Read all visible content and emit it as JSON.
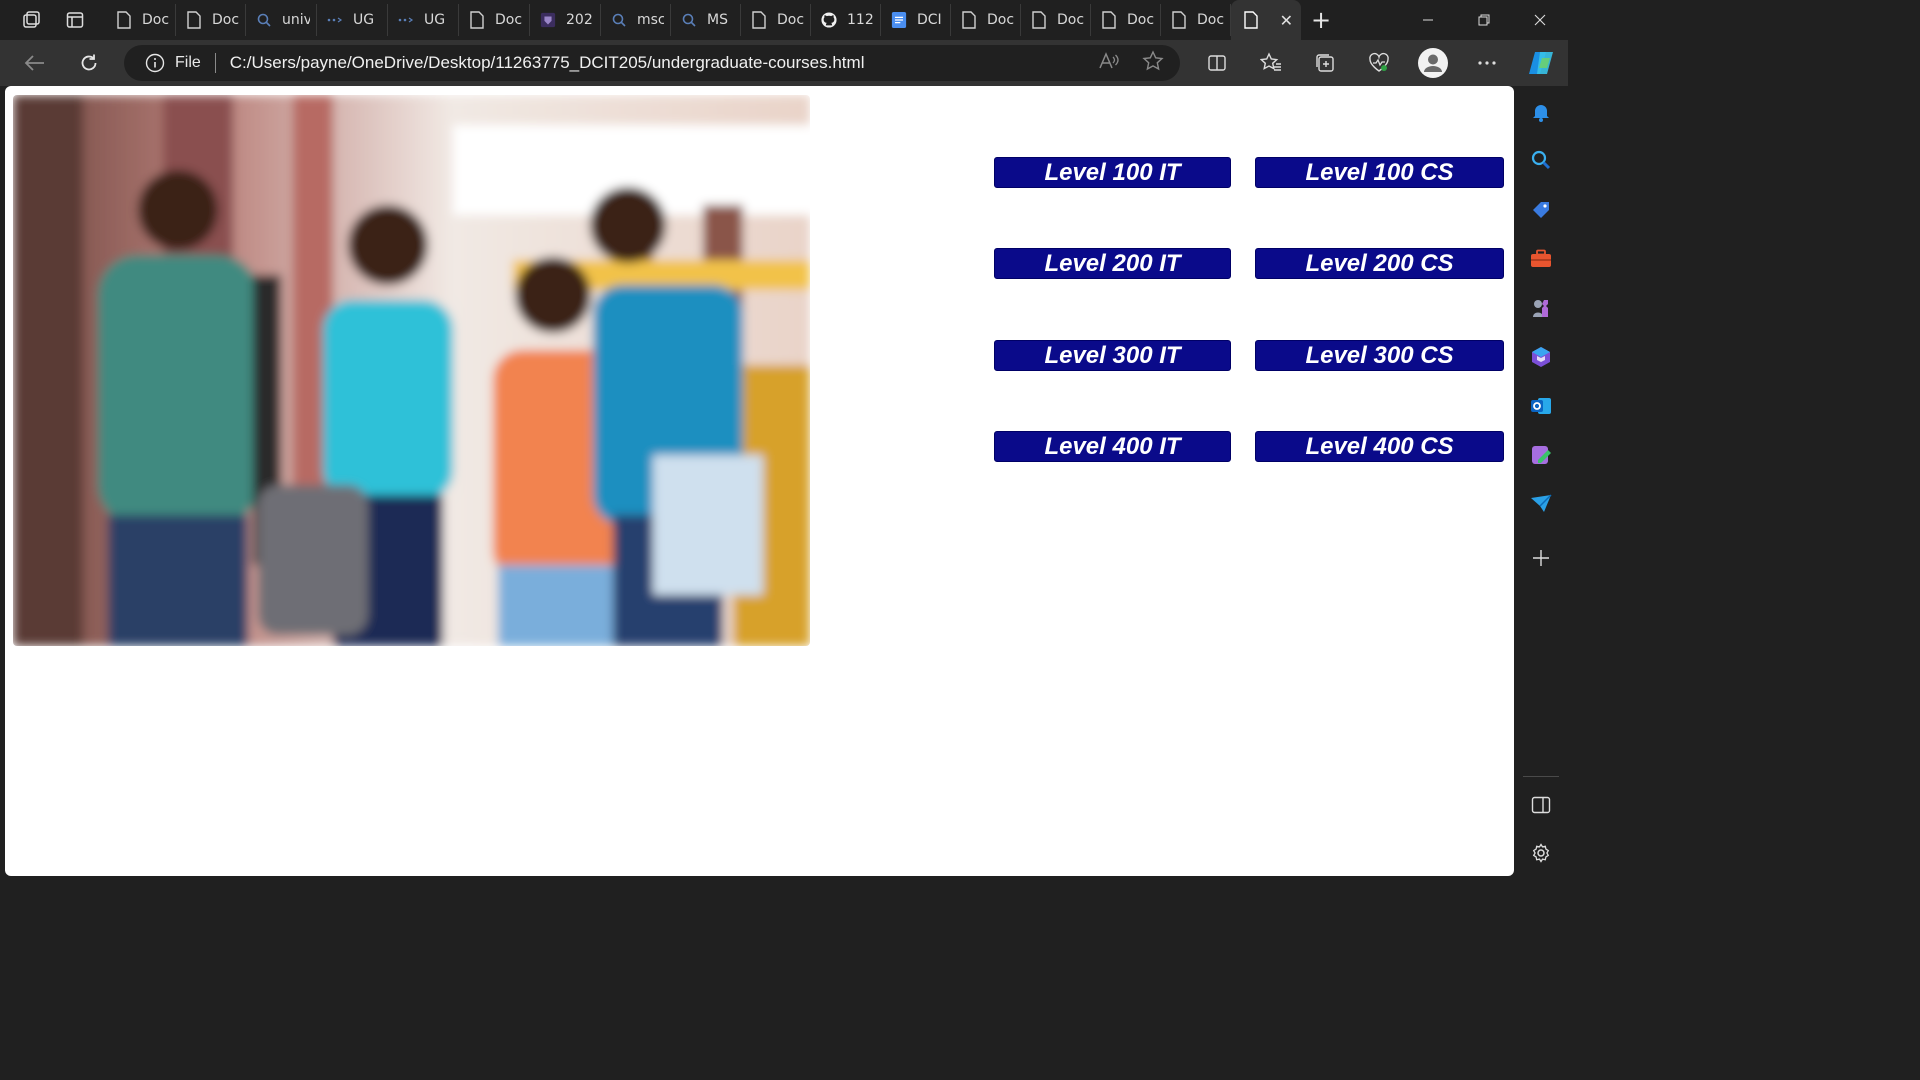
{
  "browser": {
    "tabs": [
      {
        "title": "Doc",
        "icon": "document-icon"
      },
      {
        "title": "Doc",
        "icon": "document-icon"
      },
      {
        "title": "univ",
        "icon": "search-icon"
      },
      {
        "title": "UG",
        "icon": "dots-icon"
      },
      {
        "title": "UG",
        "icon": "dots-icon"
      },
      {
        "title": "Doc",
        "icon": "document-icon"
      },
      {
        "title": "202",
        "icon": "crest-icon"
      },
      {
        "title": "msc",
        "icon": "search-icon"
      },
      {
        "title": "MS",
        "icon": "search-icon"
      },
      {
        "title": "Doc",
        "icon": "document-icon"
      },
      {
        "title": "112",
        "icon": "github-icon"
      },
      {
        "title": "DCI",
        "icon": "docs-icon"
      },
      {
        "title": "Doc",
        "icon": "document-icon"
      },
      {
        "title": "Doc",
        "icon": "document-icon"
      },
      {
        "title": "Doc",
        "icon": "document-icon"
      },
      {
        "title": "Doc",
        "icon": "document-icon"
      }
    ],
    "active_tab_close": "✕",
    "new_tab": "+",
    "address": {
      "scheme_label": "File",
      "url": "C:/Users/payne/OneDrive/Desktop/11263775_DCIT205/undergraduate-courses.html"
    }
  },
  "page": {
    "hero_image_alt": "students",
    "courses": {
      "it": [
        "Level 100 IT",
        "Level 200 IT",
        "Level 300 IT",
        "Level 400 IT"
      ],
      "cs": [
        "Level 100 CS",
        "Level 200 CS",
        "Level 300 CS",
        "Level 400 CS"
      ]
    },
    "button_color": "#0a0a8a"
  }
}
